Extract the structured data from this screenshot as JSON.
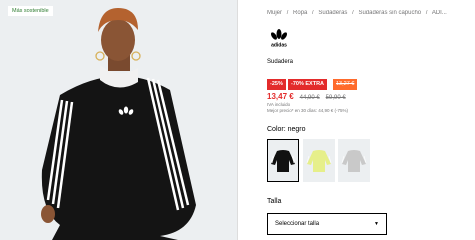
{
  "badge": "Más sostenible",
  "breadcrumb": [
    "Mujer",
    "/",
    "Ropa",
    "/",
    "Sudaderas",
    "/",
    "Sudaderas sin capucho",
    "/",
    "ADI..."
  ],
  "brand": "adidas",
  "product_name": "Sudadera",
  "pills": {
    "discount": "-25%",
    "extra": "-70% EXTRA",
    "extra_price": "13,27 €"
  },
  "price": {
    "current": "13,47 €",
    "old1": "44,90 €",
    "old2": "59,90 €"
  },
  "iva_note": "IVA incluido",
  "best_price_note": "Mejor precio* en 30 días: 44,90 € (-75%)",
  "color": {
    "label": "Color: negro",
    "swatches": [
      "negro",
      "amarillo",
      "gris"
    ]
  },
  "size": {
    "label": "Talla",
    "placeholder": "Seleccionar talla"
  },
  "colors": {
    "sale": "#e32b2b",
    "extra": "#ff6b2c",
    "sustainable": "#2f7d32"
  }
}
